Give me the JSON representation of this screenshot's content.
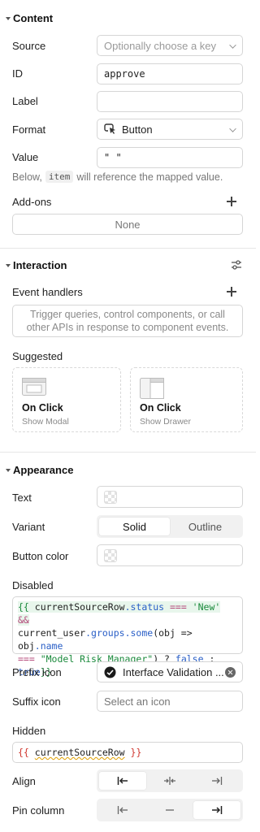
{
  "content": {
    "title": "Content",
    "source": {
      "label": "Source",
      "placeholder": "Optionally choose a key"
    },
    "id": {
      "label": "ID",
      "value": "approve"
    },
    "label_field": {
      "label": "Label",
      "value": ""
    },
    "format": {
      "label": "Format",
      "value": "Button",
      "icon": "cursor-click-icon"
    },
    "value": {
      "label": "Value",
      "value": "\" \"",
      "hint_before": "Below,",
      "hint_code": "item",
      "hint_after": "will reference the mapped value."
    },
    "addons": {
      "label": "Add-ons",
      "value": "None"
    }
  },
  "interaction": {
    "title": "Interaction",
    "event_handlers": {
      "label": "Event handlers",
      "placeholder": "Trigger queries, control components, or call other APIs in response to component events."
    },
    "suggested": {
      "label": "Suggested",
      "cards": [
        {
          "title": "On Click",
          "subtitle": "Show Modal",
          "icon": "modal-icon"
        },
        {
          "title": "On Click",
          "subtitle": "Show Drawer",
          "icon": "drawer-icon"
        }
      ]
    }
  },
  "appearance": {
    "title": "Appearance",
    "text": {
      "label": "Text"
    },
    "variant": {
      "label": "Variant",
      "options": [
        "Solid",
        "Outline"
      ],
      "selected": "Solid"
    },
    "button_color": {
      "label": "Button color"
    },
    "disabled": {
      "label": "Disabled",
      "code": {
        "open": "{{",
        "obj1": "currentSourceRow",
        "prop1": ".status",
        "eq": " === ",
        "str1": "'New'",
        "and": " &&",
        "obj2": "current_user",
        "prop2": ".groups",
        "prop3": ".some",
        "args": "(obj => obj",
        "prop4": ".name",
        "eq2": "=== ",
        "str2": "\"Model Risk Manager\"",
        "tern": ") ? ",
        "false": "false",
        "colon": " :",
        "true": "true",
        "close": "}}"
      }
    },
    "prefix_icon": {
      "label": "Prefix icon",
      "value": "Interface Validation ..."
    },
    "suffix_icon": {
      "label": "Suffix icon",
      "placeholder": "Select an icon"
    },
    "hidden": {
      "label": "Hidden",
      "open": "{{",
      "var": "currentSourceRow",
      "close": "}}"
    },
    "align": {
      "label": "Align",
      "options": [
        "align-left-icon",
        "align-center-icon",
        "align-right-icon"
      ],
      "selected": 0
    },
    "pin_column": {
      "label": "Pin column",
      "options": [
        "pin-left-icon",
        "pin-none-icon",
        "pin-right-icon"
      ],
      "selected": 2
    }
  }
}
